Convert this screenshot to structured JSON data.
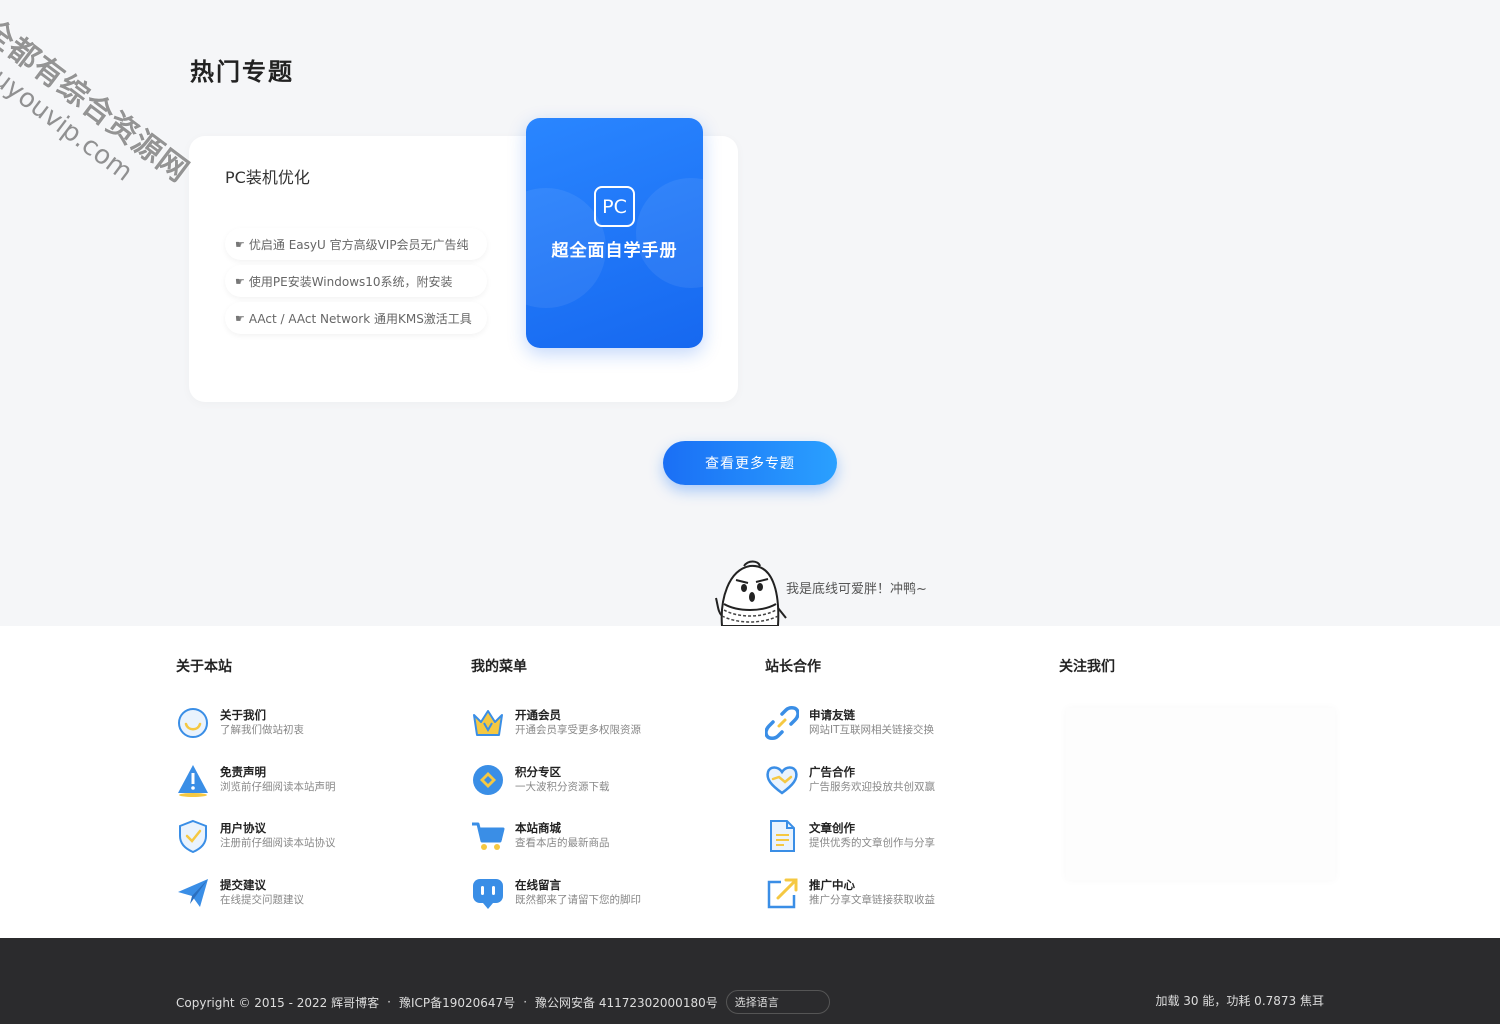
{
  "watermark": {
    "line1": "全都有综合资源网",
    "line2": "douyouvip.com"
  },
  "section": {
    "title": "热门专题"
  },
  "topic": {
    "name": "PC装机优化",
    "items": [
      "优启通 EasyU 官方高级VIP会员无广告纯",
      "使用PE安装Windows10系统，附安装",
      "AAct / AAct Network 通用KMS激活工具"
    ],
    "cover": {
      "badge": "PC",
      "title": "超全面自学手册"
    }
  },
  "more_button": "查看更多专题",
  "bottom_line": {
    "text": "我是底线可爱胖！冲鸭~"
  },
  "footer": {
    "columns": [
      {
        "title": "关于本站",
        "items": [
          {
            "title": "关于我们",
            "desc": "了解我们做站初衷",
            "icon": "smile-icon"
          },
          {
            "title": "免责声明",
            "desc": "浏览前仔细阅读本站声明",
            "icon": "warning-icon"
          },
          {
            "title": "用户协议",
            "desc": "注册前仔细阅读本站协议",
            "icon": "shield-icon"
          },
          {
            "title": "提交建议",
            "desc": "在线提交问题建议",
            "icon": "paper-plane-icon"
          }
        ]
      },
      {
        "title": "我的菜单",
        "items": [
          {
            "title": "开通会员",
            "desc": "开通会员享受更多权限资源",
            "icon": "crown-icon"
          },
          {
            "title": "积分专区",
            "desc": "一大波积分资源下载",
            "icon": "coin-icon"
          },
          {
            "title": "本站商城",
            "desc": "查看本店的最新商品",
            "icon": "cart-icon"
          },
          {
            "title": "在线留言",
            "desc": "既然都来了请留下您的脚印",
            "icon": "message-icon"
          }
        ]
      },
      {
        "title": "站长合作",
        "items": [
          {
            "title": "申请友链",
            "desc": "网站IT互联网相关链接交换",
            "icon": "link-icon"
          },
          {
            "title": "广告合作",
            "desc": "广告服务欢迎投放共创双赢",
            "icon": "handshake-icon"
          },
          {
            "title": "文章创作",
            "desc": "提供优秀的文章创作与分享",
            "icon": "document-icon"
          },
          {
            "title": "推广中心",
            "desc": "推广分享文章链接获取收益",
            "icon": "share-icon"
          }
        ]
      },
      {
        "title": "关注我们",
        "items": []
      }
    ]
  },
  "footer_bottom": {
    "copyright": "Copyright © 2015 - 2022 辉哥博客",
    "icp": "豫ICP备19020647号",
    "police": "豫公网安备 41172302000180号",
    "language": "选择语言",
    "stats": "加载 30 能，功耗 0.7873 焦耳"
  },
  "colors": {
    "accent": "#1a6ff5",
    "footer_dark": "#2b2b2d",
    "icon_blue": "#3a8ee6",
    "icon_yellow": "#f5c842"
  }
}
